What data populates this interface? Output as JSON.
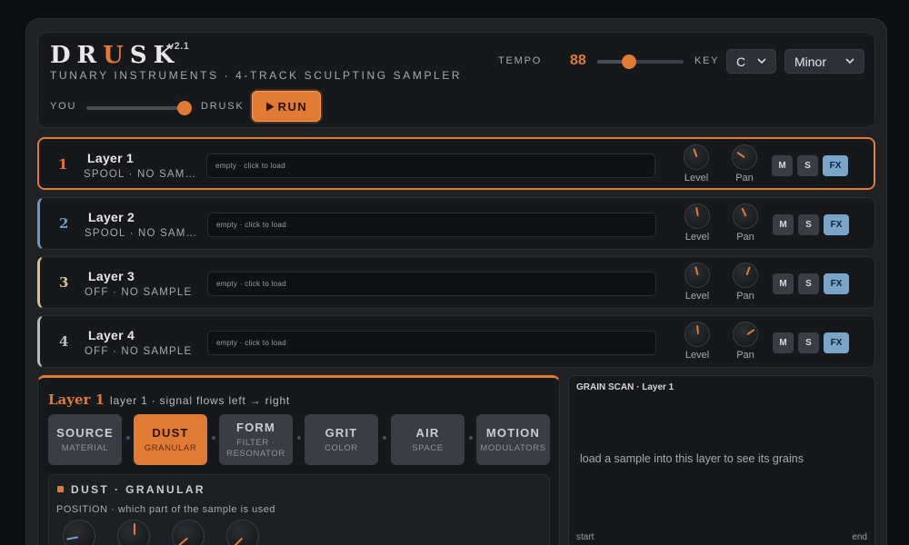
{
  "header": {
    "logo_parts": [
      "DR",
      "U",
      "SK"
    ],
    "version": "v2.1",
    "subtitle": "TUNARY INSTRUMENTS · 4-TRACK SCULPTING SAMPLER",
    "you_label": "YOU",
    "drusk_label": "DRUSK",
    "blend_value": 0.94,
    "run_label": "RUN",
    "tempo_label": "TEMPO",
    "tempo_value": "88",
    "tempo_slider_value": 0.37,
    "key_label": "KEY",
    "key_value": "C",
    "scale_value": "Minor"
  },
  "colors": {
    "accent": "#e07a35",
    "layer_colors": [
      "#e07a35",
      "#6b9ac4",
      "#d6c28a",
      "#b8bcc1"
    ],
    "fx_active": "#7aa5c8"
  },
  "layers": [
    {
      "num": "1",
      "name": "Layer 1",
      "status": "SPOOL · NO SAMPLE",
      "drop_text": "empty · click to load",
      "level_label": "Level",
      "pan_label": "Pan",
      "m": "M",
      "s": "S",
      "fx": "FX"
    },
    {
      "num": "2",
      "name": "Layer 2",
      "status": "SPOOL · NO SAMPLE",
      "drop_text": "empty · click to load",
      "level_label": "Level",
      "pan_label": "Pan",
      "m": "M",
      "s": "S",
      "fx": "FX"
    },
    {
      "num": "3",
      "name": "Layer 3",
      "status": "OFF · NO SAMPLE",
      "drop_text": "empty · click to load",
      "level_label": "Level",
      "pan_label": "Pan",
      "m": "M",
      "s": "S",
      "fx": "FX"
    },
    {
      "num": "4",
      "name": "Layer 4",
      "status": "OFF · NO SAMPLE",
      "drop_text": "empty · click to load",
      "level_label": "Level",
      "pan_label": "Pan",
      "m": "M",
      "s": "S",
      "fx": "FX"
    }
  ],
  "panel": {
    "title": "Layer 1",
    "subtitle": "layer 1 · signal flows left → right",
    "tabs": [
      {
        "label": "SOURCE",
        "sub": "MATERIAL"
      },
      {
        "label": "DUST",
        "sub": "GRANULAR"
      },
      {
        "label": "FORM",
        "sub": "FILTER · RESONATOR"
      },
      {
        "label": "GRIT",
        "sub": "COLOR"
      },
      {
        "label": "AIR",
        "sub": "SPACE"
      },
      {
        "label": "MOTION",
        "sub": "MODULATORS"
      }
    ],
    "section_title": "DUST · GRANULAR",
    "section_desc": "POSITION · which part of the sample is used"
  },
  "scan": {
    "title": "GRAIN SCAN · Layer 1",
    "message": "load a sample into this layer to see its grains",
    "start_label": "start",
    "end_label": "end"
  }
}
